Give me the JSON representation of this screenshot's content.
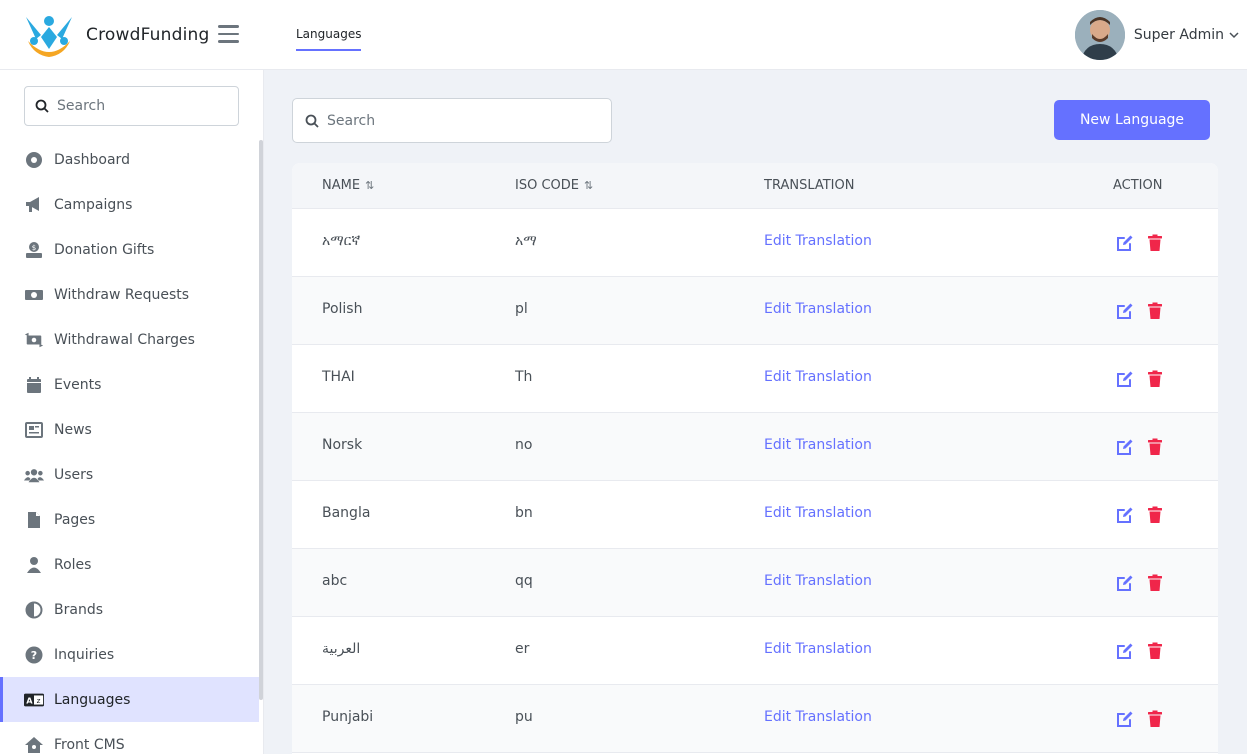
{
  "brand": {
    "name": "CrowdFunding"
  },
  "header": {
    "tab": "Languages",
    "user_name": "Super Admin"
  },
  "sidebar": {
    "search_placeholder": "Search",
    "items": [
      {
        "label": "Dashboard",
        "icon": "dashboard-icon"
      },
      {
        "label": "Campaigns",
        "icon": "megaphone-icon"
      },
      {
        "label": "Donation Gifts",
        "icon": "gift-icon"
      },
      {
        "label": "Withdraw Requests",
        "icon": "money-icon"
      },
      {
        "label": "Withdrawal Charges",
        "icon": "exchange-icon"
      },
      {
        "label": "Events",
        "icon": "calendar-icon"
      },
      {
        "label": "News",
        "icon": "newspaper-icon"
      },
      {
        "label": "Users",
        "icon": "users-icon"
      },
      {
        "label": "Pages",
        "icon": "file-icon"
      },
      {
        "label": "Roles",
        "icon": "user-icon"
      },
      {
        "label": "Brands",
        "icon": "half-circle-icon"
      },
      {
        "label": "Inquiries",
        "icon": "question-icon"
      },
      {
        "label": "Languages",
        "icon": "language-icon"
      },
      {
        "label": "Front CMS",
        "icon": "home-icon"
      }
    ],
    "active": "Languages"
  },
  "main": {
    "search_placeholder": "Search",
    "new_button": "New Language",
    "columns": {
      "name": "NAME",
      "iso": "ISO CODE",
      "translation": "TRANSLATION",
      "action": "ACTION"
    },
    "sort_icon": "⇅",
    "rows": [
      {
        "name": "አማርኛ",
        "iso": "አማ",
        "translation": "Edit Translation"
      },
      {
        "name": "Polish",
        "iso": "pl",
        "translation": "Edit Translation"
      },
      {
        "name": "THAI",
        "iso": "Th",
        "translation": "Edit Translation"
      },
      {
        "name": "Norsk",
        "iso": "no",
        "translation": "Edit Translation"
      },
      {
        "name": "Bangla",
        "iso": "bn",
        "translation": "Edit Translation"
      },
      {
        "name": "abc",
        "iso": "qq",
        "translation": "Edit Translation"
      },
      {
        "name": "العربية",
        "iso": "er",
        "translation": "Edit Translation"
      },
      {
        "name": "Punjabi",
        "iso": "pu",
        "translation": "Edit Translation"
      }
    ]
  },
  "colors": {
    "accent": "#6571ff",
    "danger": "#f0264a",
    "active_bg": "#e0e3ff"
  }
}
